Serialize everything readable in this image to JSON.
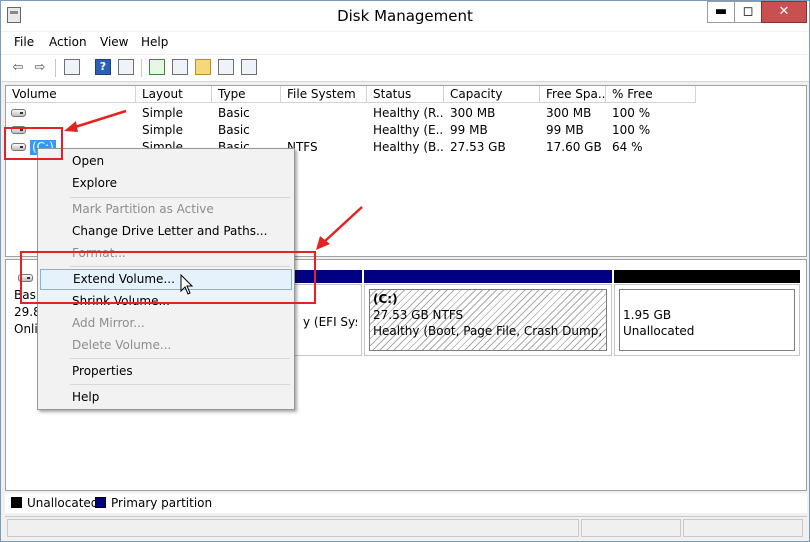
{
  "window": {
    "title": "Disk Management",
    "controls": {
      "minimize": "▬",
      "maximize": "◻",
      "close": "✕"
    }
  },
  "menubar": {
    "items": [
      "File",
      "Action",
      "View",
      "Help"
    ]
  },
  "toolbar": {
    "icons": [
      "back-arrow-icon",
      "forward-arrow-icon",
      "properties-panel-icon",
      "help-icon",
      "show-hide-pane-icon",
      "refresh-icon",
      "settings-icon",
      "open-folder-icon",
      "search-icon",
      "console-icon"
    ]
  },
  "volume_list": {
    "columns": [
      "Volume",
      "Layout",
      "Type",
      "File System",
      "Status",
      "Capacity",
      "Free Spa...",
      "% Free"
    ],
    "rows": [
      {
        "volume": "",
        "layout": "Simple",
        "type": "Basic",
        "fs": "",
        "status": "Healthy (R...",
        "capacity": "300 MB",
        "free": "300 MB",
        "pct": "100 %"
      },
      {
        "volume": "",
        "layout": "Simple",
        "type": "Basic",
        "fs": "",
        "status": "Healthy (E...",
        "capacity": "99 MB",
        "free": "99 MB",
        "pct": "100 %"
      },
      {
        "volume": "(C:)",
        "layout": "Simple",
        "type": "Basic",
        "fs": "NTFS",
        "status": "Healthy (B...",
        "capacity": "27.53 GB",
        "free": "17.60 GB",
        "pct": "64 %"
      }
    ]
  },
  "disk_graph": {
    "disk_labels": [
      "Basi",
      "29.8",
      "Onli"
    ],
    "efi_partition_status": "y (EFI Syster",
    "c_partition": {
      "name": "(C:)",
      "size": "27.53 GB NTFS",
      "status": "Healthy (Boot, Page File, Crash Dump, Prima"
    },
    "unallocated": {
      "size": "1.95 GB",
      "label": "Unallocated"
    },
    "colors": {
      "primary": "#000080",
      "unallocated": "#000000"
    }
  },
  "legend": {
    "unallocated": "Unallocated",
    "primary": "Primary partition"
  },
  "context_menu": {
    "items": [
      {
        "label": "Open",
        "disabled": false
      },
      {
        "label": "Explore",
        "disabled": false
      },
      {
        "label": "Mark Partition as Active",
        "disabled": true
      },
      {
        "label": "Change Drive Letter and Paths...",
        "disabled": false
      },
      {
        "label": "Format...",
        "disabled": true
      },
      {
        "label": "Extend Volume...",
        "disabled": false,
        "highlighted": true
      },
      {
        "label": "Shrink Volume...",
        "disabled": false
      },
      {
        "label": "Add Mirror...",
        "disabled": true
      },
      {
        "label": "Delete Volume...",
        "disabled": true
      },
      {
        "label": "Properties",
        "disabled": false
      },
      {
        "label": "Help",
        "disabled": false
      }
    ]
  },
  "annotation_color": "#e52222"
}
